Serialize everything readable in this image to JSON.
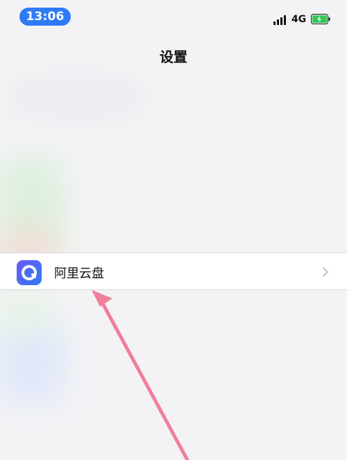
{
  "status": {
    "time": "13:06",
    "network": "4G"
  },
  "nav": {
    "title": "设置"
  },
  "row": {
    "label": "阿里云盘"
  },
  "icons": {
    "signal": "signal-bars-icon",
    "battery": "battery-charging-icon",
    "chevron": "chevron-right-icon",
    "app": "aliyun-drive-icon",
    "annotation": "pointer-arrow-icon"
  },
  "colors": {
    "time_pill": "#2f7bf6",
    "battery_green": "#34c759",
    "arrow": "#ef7f9a"
  }
}
